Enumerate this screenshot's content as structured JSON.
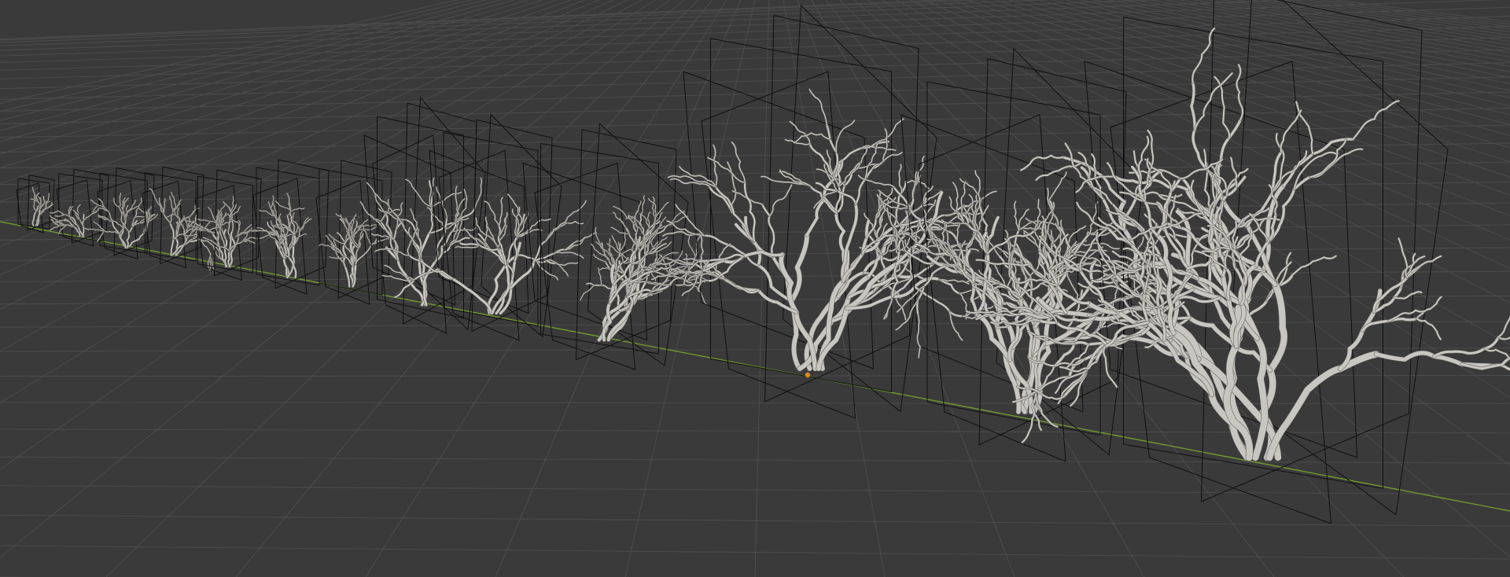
{
  "viewport": {
    "background": "#3a3a3a",
    "grid_color": "#4c4c4c",
    "x_axis_color": "#6f9a2e",
    "wireframe_color": "#101010",
    "branch_light": "#c8c6c0",
    "branch_dark": "#5a5854",
    "origin_color": "#e08a1a"
  },
  "objects": [
    {
      "id": "shrub-01"
    },
    {
      "id": "shrub-02"
    },
    {
      "id": "shrub-03"
    },
    {
      "id": "shrub-04"
    },
    {
      "id": "shrub-05"
    },
    {
      "id": "shrub-06"
    },
    {
      "id": "shrub-07"
    },
    {
      "id": "shrub-08"
    },
    {
      "id": "shrub-09"
    },
    {
      "id": "shrub-10"
    },
    {
      "id": "shrub-11"
    },
    {
      "id": "shrub-12"
    },
    {
      "id": "shrub-13"
    }
  ]
}
